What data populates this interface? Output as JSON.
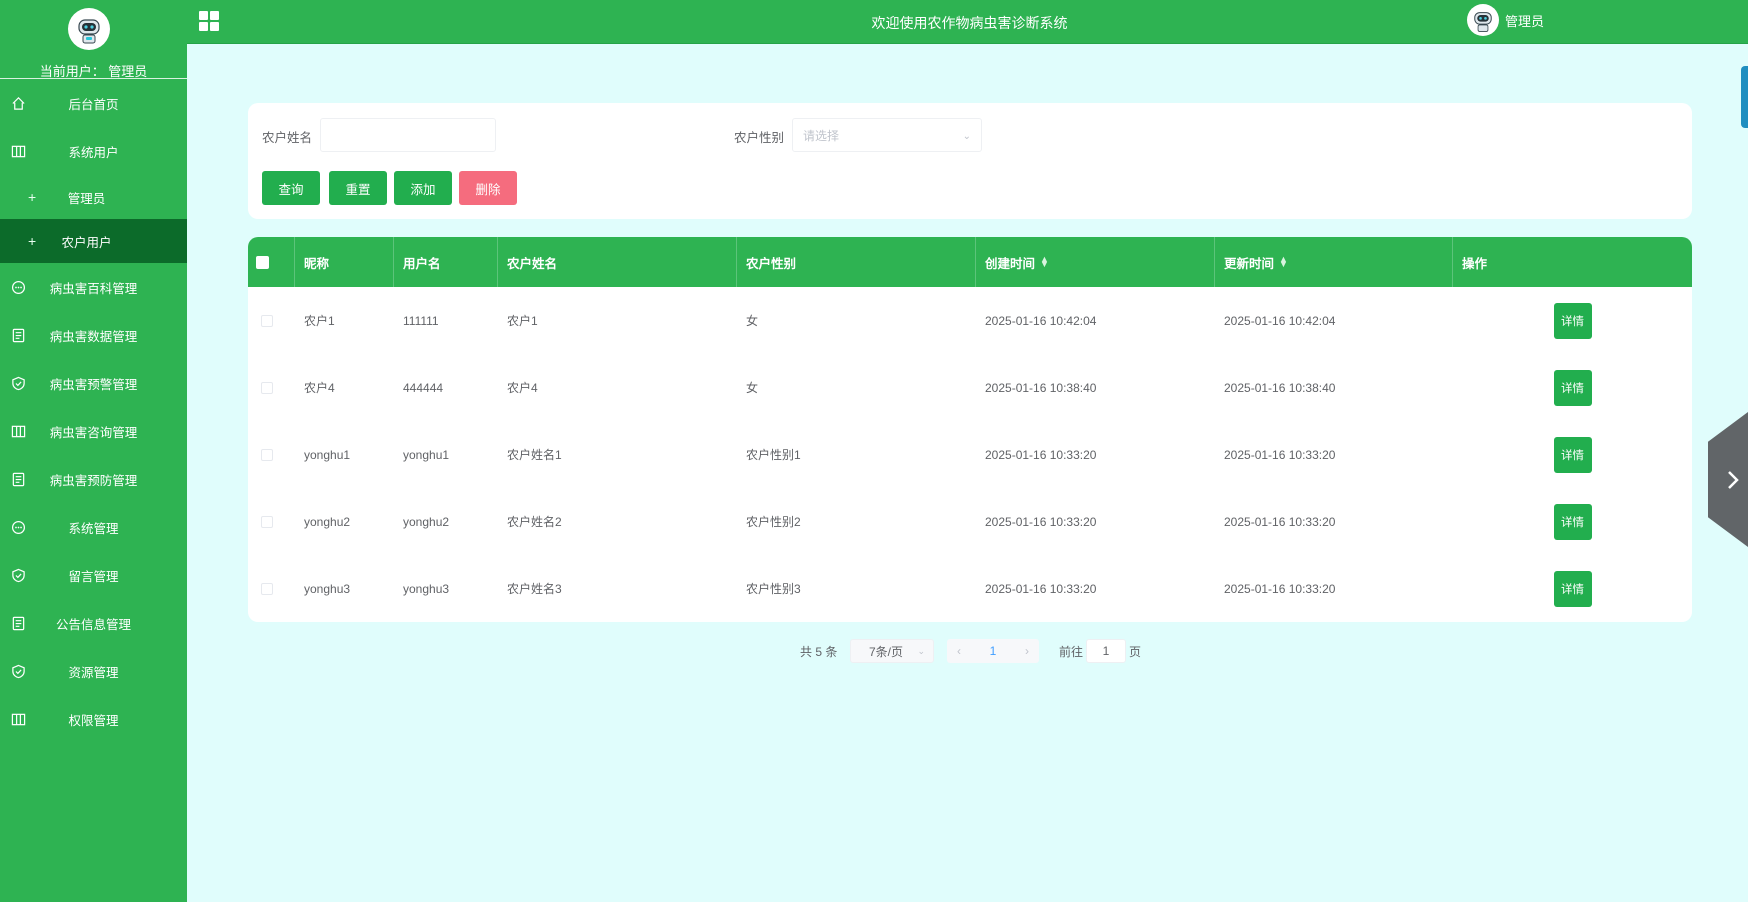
{
  "sidebar": {
    "current_user_label": "当前用户： 管理员",
    "items": [
      {
        "label": "后台首页",
        "icon": "home-icon"
      },
      {
        "label": "系统用户",
        "icon": "columns-icon"
      },
      {
        "label": "管理员",
        "icon": "plus-icon",
        "sub": true
      },
      {
        "label": "农户用户",
        "icon": "plus-icon",
        "sub": true,
        "active": true
      },
      {
        "label": "病虫害百科管理",
        "icon": "chat-icon"
      },
      {
        "label": "病虫害数据管理",
        "icon": "document-icon"
      },
      {
        "label": "病虫害预警管理",
        "icon": "shield-check-icon"
      },
      {
        "label": "病虫害咨询管理",
        "icon": "columns-icon"
      },
      {
        "label": "病虫害预防管理",
        "icon": "document-icon"
      },
      {
        "label": "系统管理",
        "icon": "chat-icon"
      },
      {
        "label": "留言管理",
        "icon": "shield-check-icon"
      },
      {
        "label": "公告信息管理",
        "icon": "document-icon"
      },
      {
        "label": "资源管理",
        "icon": "shield-check-icon"
      },
      {
        "label": "权限管理",
        "icon": "columns-icon"
      }
    ]
  },
  "topbar": {
    "title": "欢迎使用农作物病虫害诊断系统",
    "username": "管理员"
  },
  "search": {
    "name_label": "农户姓名",
    "name_value": "",
    "gender_label": "农户性别",
    "gender_placeholder": "请选择",
    "buttons": {
      "query": "查询",
      "reset": "重置",
      "add": "添加",
      "delete": "删除"
    }
  },
  "table": {
    "columns": [
      "昵称",
      "用户名",
      "农户姓名",
      "农户性别",
      "创建时间",
      "更新时间",
      "操作"
    ],
    "detail_label": "详情",
    "rows": [
      {
        "nickname": "农户1",
        "username": "111111",
        "name": "农户1",
        "gender": "女",
        "created": "2025-01-16 10:42:04",
        "updated": "2025-01-16 10:42:04"
      },
      {
        "nickname": "农户4",
        "username": "444444",
        "name": "农户4",
        "gender": "女",
        "created": "2025-01-16 10:38:40",
        "updated": "2025-01-16 10:38:40"
      },
      {
        "nickname": "yonghu1",
        "username": "yonghu1",
        "name": "农户姓名1",
        "gender": "农户性别1",
        "created": "2025-01-16 10:33:20",
        "updated": "2025-01-16 10:33:20"
      },
      {
        "nickname": "yonghu2",
        "username": "yonghu2",
        "name": "农户姓名2",
        "gender": "农户性别2",
        "created": "2025-01-16 10:33:20",
        "updated": "2025-01-16 10:33:20"
      },
      {
        "nickname": "yonghu3",
        "username": "yonghu3",
        "name": "农户姓名3",
        "gender": "农户性别3",
        "created": "2025-01-16 10:33:20",
        "updated": "2025-01-16 10:33:20"
      }
    ]
  },
  "pagination": {
    "total": "共 5 条",
    "page_size": "7条/页",
    "current_page": "1",
    "goto_label": "前往",
    "goto_value": "1",
    "page_suffix": "页"
  },
  "colors": {
    "primary_green": "#2eb352",
    "active_menu": "#0c6b2a",
    "delete_red": "#f56c7e",
    "page_bg": "#e0fdfc"
  }
}
